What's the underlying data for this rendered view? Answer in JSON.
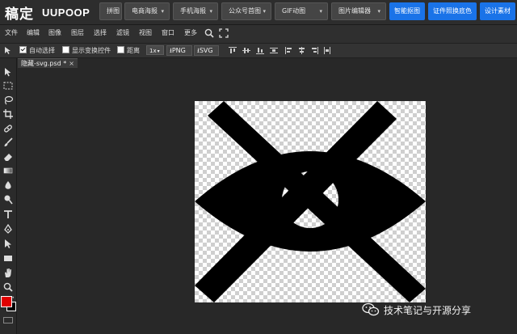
{
  "brand": {
    "cn": "稿定",
    "en": "UUPOOP"
  },
  "topnav": {
    "items": [
      {
        "label": "拼图",
        "dropdown": false
      },
      {
        "label": "电商海报",
        "dropdown": true
      },
      {
        "label": "手机海报",
        "dropdown": true
      },
      {
        "label": "公众号首图",
        "dropdown": true
      },
      {
        "label": "GIF动图",
        "dropdown": true
      },
      {
        "label": "图片编辑器",
        "dropdown": true
      }
    ],
    "actions": [
      {
        "label": "智能抠图"
      },
      {
        "label": "证件照换底色"
      },
      {
        "label": "设计素材"
      }
    ]
  },
  "menubar": {
    "items": [
      "文件",
      "编辑",
      "图像",
      "图层",
      "选择",
      "滤镜",
      "视图",
      "窗口",
      "更多"
    ],
    "icons": [
      "search-icon",
      "fullscreen-icon"
    ]
  },
  "options": {
    "auto_select": {
      "label": "自动选择",
      "checked": true
    },
    "show_transform": {
      "label": "显示变换控件",
      "checked": false
    },
    "distance": {
      "label": "距离",
      "checked": false
    },
    "zoom": "1x",
    "export_png": "PNG",
    "export_svg": "SVG"
  },
  "tools": [
    "move-tool-icon",
    "marquee-tool-icon",
    "lasso-tool-icon",
    "crop-tool-icon",
    "healing-brush-icon",
    "brush-tool-icon",
    "eraser-tool-icon",
    "gradient-tool-icon",
    "blur-tool-icon",
    "dodge-tool-icon",
    "type-tool-icon",
    "pen-tool-icon",
    "path-select-icon",
    "shape-tool-icon",
    "hand-tool-icon",
    "zoom-tool-icon"
  ],
  "colors": {
    "foreground": "#e00000",
    "background": "#000000",
    "accent": "#1a73e8"
  },
  "document": {
    "tab_title": "隐藏-svg.psd *",
    "close": "×"
  },
  "watermark": {
    "text": "技术笔记与开源分享"
  }
}
